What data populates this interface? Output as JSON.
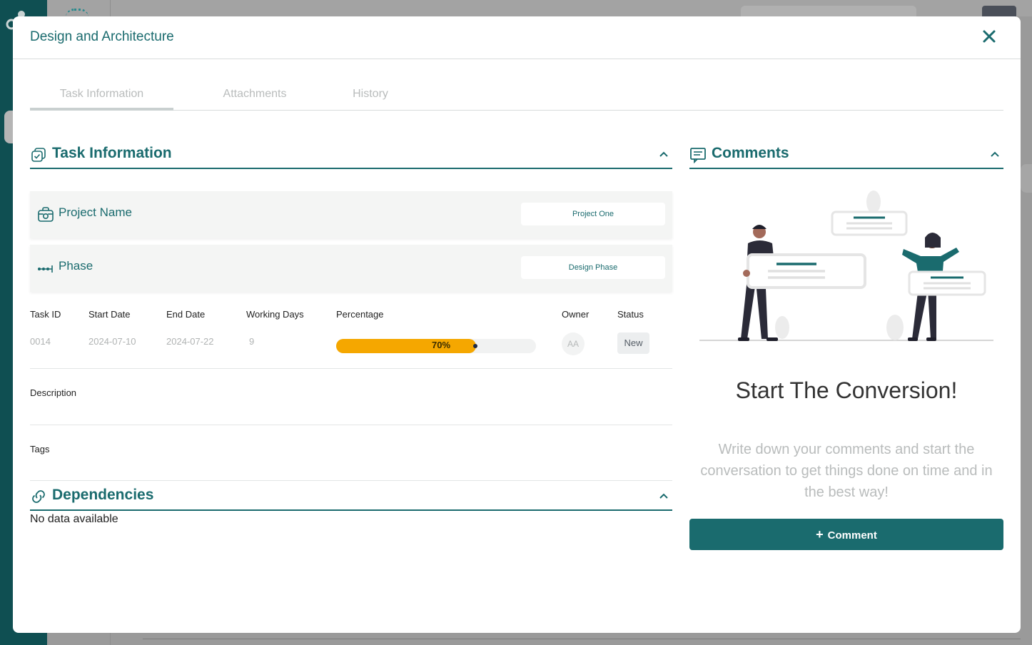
{
  "modal": {
    "title": "Design and Architecture",
    "close_icon": "close-icon"
  },
  "tabs": [
    {
      "label": "Task Information",
      "active": true
    },
    {
      "label": "Attachments",
      "active": false
    },
    {
      "label": "History",
      "active": false
    }
  ],
  "task_info": {
    "section_title": "Task Information",
    "project_label": "Project Name",
    "project_value": "Project One",
    "phase_label": "Phase",
    "phase_value": "Design Phase",
    "columns": {
      "task_id": "Task ID",
      "start_date": "Start Date",
      "end_date": "End Date",
      "working_days": "Working Days",
      "percentage": "Percentage",
      "owner": "Owner",
      "status": "Status"
    },
    "values": {
      "task_id": "0014",
      "start_date": "2024-07-10",
      "end_date": "2024-07-22",
      "working_days": "9",
      "percentage_text": "70%",
      "percentage_value": 0.7,
      "owner_initials": "AA",
      "status": "New"
    },
    "description_label": "Description",
    "tags_label": "Tags"
  },
  "dependencies": {
    "section_title": "Dependencies",
    "empty_text": "No data available"
  },
  "comments": {
    "section_title": "Comments",
    "empty_title": "Start The Conversion!",
    "empty_text": "Write down your comments and start the conversation to get things done on time and in the best way!",
    "button_label": "Comment"
  },
  "colors": {
    "accent": "#1a6b6e",
    "progress": "#f5a700"
  }
}
